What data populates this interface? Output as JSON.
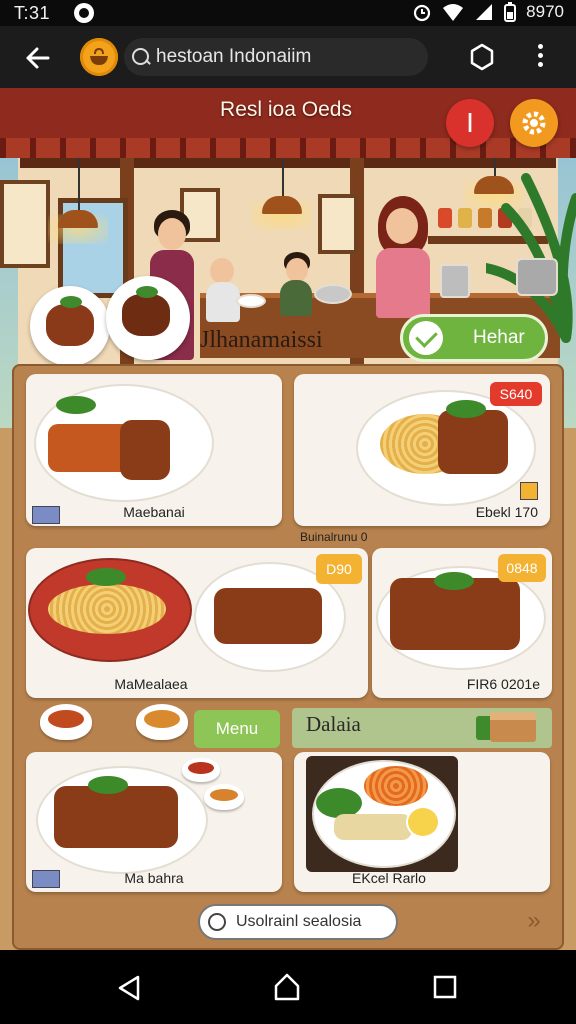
{
  "status_bar": {
    "time": "T:31",
    "battery_text": "8970",
    "icons": [
      "alarm-icon",
      "wifi-icon",
      "signal-icon",
      "battery-icon"
    ]
  },
  "app_bar": {
    "search_value": "hestoan Indonaiim",
    "icons": [
      "back-arrow-icon",
      "app-logo-icon",
      "search-icon",
      "share-icon",
      "more-vert-icon"
    ]
  },
  "hero": {
    "title": "Resl ioa Oeds",
    "badge_text": "I",
    "colors": {
      "badge": "#d9322c",
      "settings": "#f29a1f"
    }
  },
  "category": {
    "title": "Jlhanamaissi",
    "halal_label": "Hehar"
  },
  "menu_cards": [
    {
      "caption": "Maebanai",
      "price": ""
    },
    {
      "caption": "Ebekl 170",
      "price": "S640",
      "sub_caption": "Buinalrunu 0"
    },
    {
      "caption": "MaMealaea",
      "price": "D90"
    },
    {
      "caption": "FIR6 0201e",
      "price": "0848"
    },
    {
      "caption": "Ma bahra",
      "price": ""
    },
    {
      "caption": "EKcel Rarlo",
      "price": ""
    }
  ],
  "sections": {
    "menu_button": "Menu",
    "dalaia_label": "Dalaia"
  },
  "bottom": {
    "search_label": "Usolrainl sealosia",
    "next_icon": "double-chevron-right-icon"
  },
  "nav": {
    "icons": [
      "nav-back-icon",
      "nav-home-icon",
      "nav-recents-icon"
    ]
  }
}
